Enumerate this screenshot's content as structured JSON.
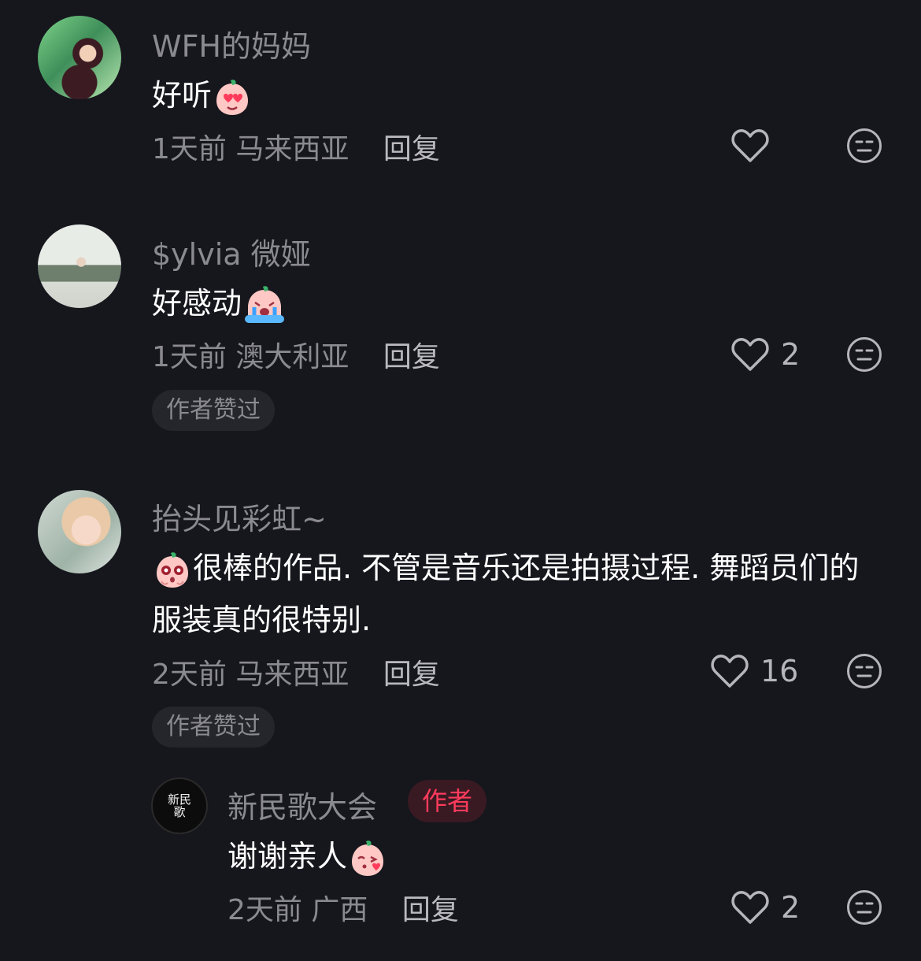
{
  "comments": [
    {
      "user": "WFH的妈妈",
      "text": "好听",
      "emoji": "heart-eyes-emoji",
      "time": "1天前",
      "location": "马来西亚",
      "reply_label": "回复",
      "likes": ""
    },
    {
      "user": "$ylvia 微娅",
      "text": "好感动",
      "emoji": "crying-emoji",
      "time": "1天前",
      "location": "澳大利亚",
      "reply_label": "回复",
      "likes": "2",
      "badge": "作者赞过"
    },
    {
      "user": "抬头见彩虹~",
      "text": "很棒的作品. 不管是音乐还是拍摄过程. 舞蹈员们的服装真的很特别.",
      "emoji": "starry-eyes-emoji",
      "time": "2天前",
      "location": "马来西亚",
      "reply_label": "回复",
      "likes": "16",
      "badge": "作者赞过"
    }
  ],
  "reply": {
    "user": "新民歌大会",
    "author_tag": "作者",
    "avatar_text": "新民歌",
    "text": "谢谢亲人",
    "emoji": "blow-kiss-emoji",
    "time": "2天前",
    "location": "广西",
    "reply_label": "回复",
    "likes": "2"
  },
  "colors": {
    "background": "#16161d",
    "secondary_text": "#8a8a90",
    "author_accent": "#ff3b5c"
  }
}
